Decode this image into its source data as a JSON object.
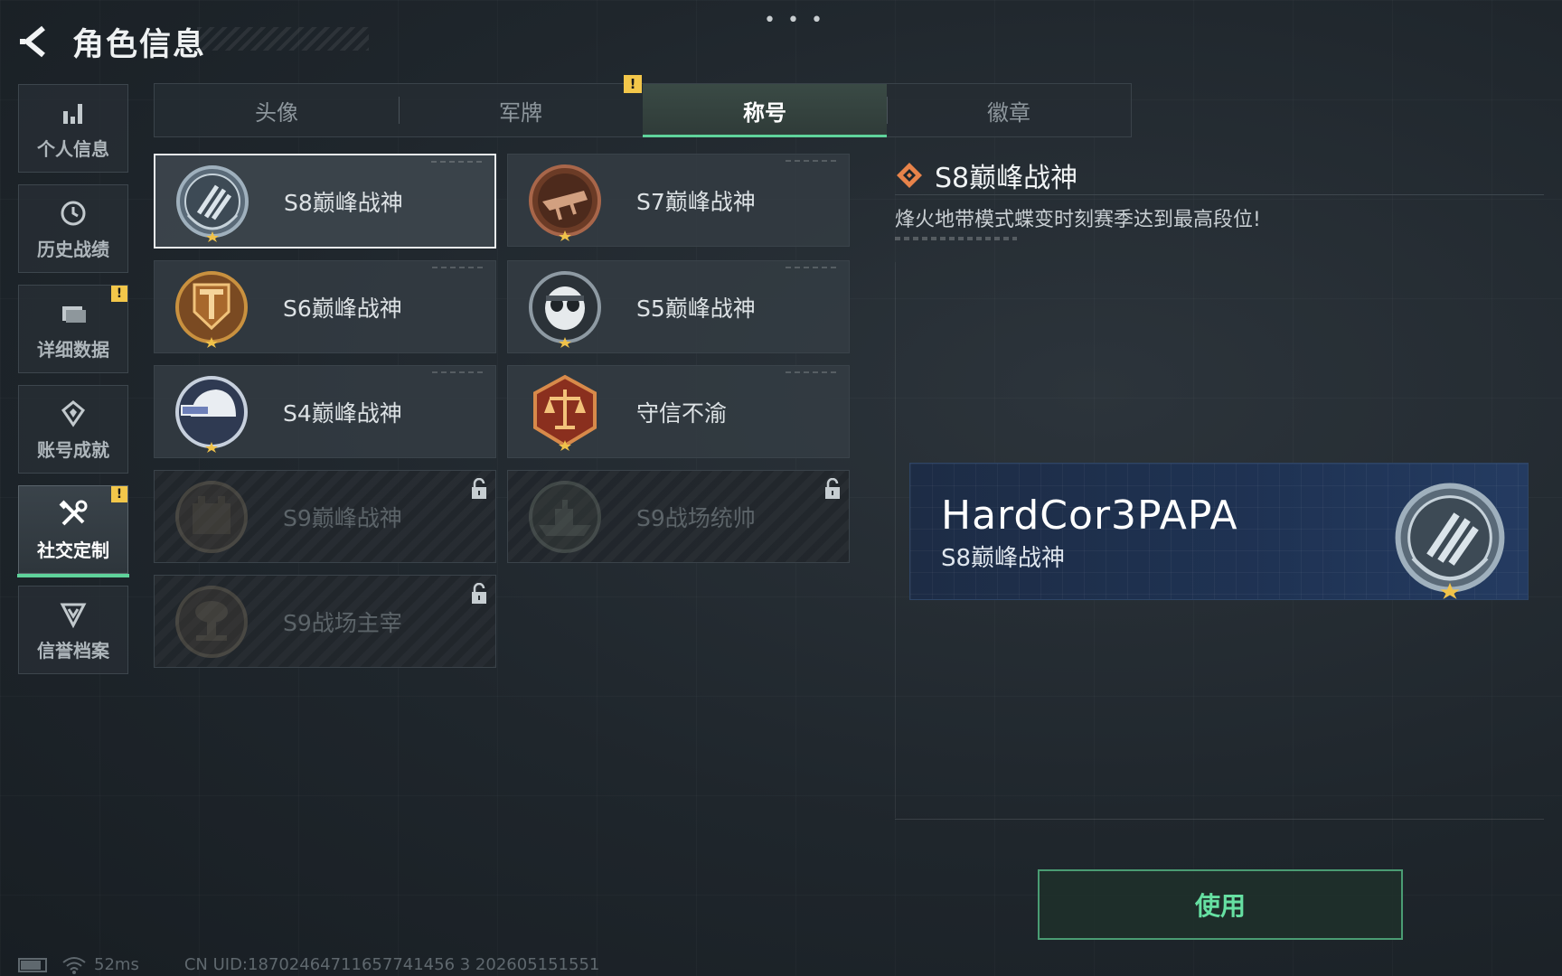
{
  "header": {
    "title": "角色信息"
  },
  "sidebar": {
    "items": [
      {
        "label": "个人信息",
        "icon": "bar-chart-icon",
        "badge": ""
      },
      {
        "label": "历史战绩",
        "icon": "history-icon",
        "badge": ""
      },
      {
        "label": "详细数据",
        "icon": "folder-icon",
        "badge": "!"
      },
      {
        "label": "账号成就",
        "icon": "achievement-icon",
        "badge": ""
      },
      {
        "label": "社交定制",
        "icon": "tools-icon",
        "badge": "!",
        "active": true
      },
      {
        "label": "信誉档案",
        "icon": "credit-icon",
        "badge": ""
      }
    ]
  },
  "tabs": [
    {
      "label": "头像"
    },
    {
      "label": "军牌",
      "badge": "!"
    },
    {
      "label": "称号",
      "active": true
    },
    {
      "label": "徽章"
    }
  ],
  "titles": [
    {
      "name": "S8巅峰战神",
      "emblem": "s8-emblem",
      "selected": true,
      "locked": false
    },
    {
      "name": "S7巅峰战神",
      "emblem": "s7-emblem",
      "selected": false,
      "locked": false
    },
    {
      "name": "S6巅峰战神",
      "emblem": "s6-emblem",
      "selected": false,
      "locked": false
    },
    {
      "name": "S5巅峰战神",
      "emblem": "s5-emblem",
      "selected": false,
      "locked": false
    },
    {
      "name": "S4巅峰战神",
      "emblem": "s4-emblem",
      "selected": false,
      "locked": false
    },
    {
      "name": "守信不渝",
      "emblem": "scales-emblem",
      "selected": false,
      "locked": false
    },
    {
      "name": "S9巅峰战神",
      "emblem": "s9-emblem",
      "selected": false,
      "locked": true
    },
    {
      "name": "S9战场统帅",
      "emblem": "s9-ship-emblem",
      "selected": false,
      "locked": true
    },
    {
      "name": "S9战场主宰",
      "emblem": "s9-nuke-emblem",
      "selected": false,
      "locked": true
    }
  ],
  "detail": {
    "title": "S8巅峰战神",
    "description": "烽火地带模式蝶变时刻赛季达到最高段位!"
  },
  "preview": {
    "player_name": "HardCor3PAPA",
    "title": "S8巅峰战神"
  },
  "actions": {
    "use_label": "使用"
  },
  "status": {
    "ping": "52ms",
    "uid": "CN UID:18702464711657741456 3 202605151551"
  },
  "colors": {
    "accent": "#5fd39b",
    "badge": "#f3c74a",
    "preview_bg": "#1f3354",
    "detail_icon": "#e8834a"
  }
}
